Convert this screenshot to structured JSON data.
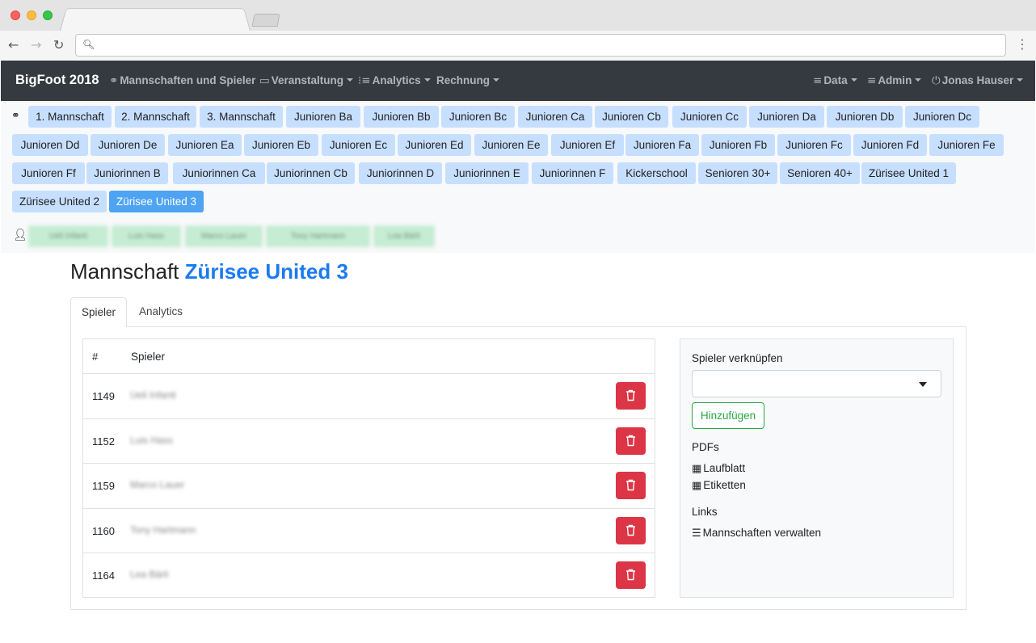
{
  "app": {
    "brand": "BigFoot 2018",
    "nav_left": [
      {
        "label": "Mannschaften und Spieler",
        "icon": "team-icon",
        "glyph": "⚭",
        "caret": false
      },
      {
        "label": "Veranstaltung",
        "icon": "calendar-icon",
        "glyph": "▭",
        "caret": true
      },
      {
        "label": "Analytics",
        "icon": "list-icon",
        "glyph": "⁝≡",
        "caret": true
      },
      {
        "label": "Rechnung",
        "icon": "",
        "glyph": "",
        "caret": true
      }
    ],
    "nav_right": [
      {
        "label": "Data",
        "icon": "menu-icon",
        "glyph": "≡",
        "caret": true
      },
      {
        "label": "Admin",
        "icon": "menu-icon",
        "glyph": "≡",
        "caret": true
      },
      {
        "label": "Jonas Hauser",
        "icon": "power-icon",
        "glyph": "⏻",
        "caret": true
      }
    ]
  },
  "teams": [
    "1. Mannschaft",
    "2. Mannschaft",
    "3. Mannschaft",
    "Junioren Ba",
    "Junioren Bb",
    "Junioren Bc",
    "Junioren Ca",
    "Junioren Cb",
    "Junioren Cc",
    "Junioren Da",
    "Junioren Db",
    "Junioren Dc",
    "Junioren Dd",
    "Junioren De",
    "Junioren Ea",
    "Junioren Eb",
    "Junioren Ec",
    "Junioren Ed",
    "Junioren Ee",
    "Junioren Ef",
    "Junioren Fa",
    "Junioren Fb",
    "Junioren Fc",
    "Junioren Fd",
    "Junioren Fe",
    "Junioren Ff",
    "Juniorinnen B",
    "Juniorinnen Ca",
    "Juniorinnen Cb",
    "Juniorinnen D",
    "Juniorinnen E",
    "Juniorinnen F",
    "Kickerschool",
    "Senioren 30+",
    "Senioren 40+",
    "Zürisee United 1",
    "Zürisee United 2",
    "Zürisee United 3"
  ],
  "active_team": "Zürisee United 3",
  "player_pills": [
    "Ueli Infanti",
    "Luis Hass",
    "Marco Lauer",
    "Tony Hartmann",
    "Lea Bärli"
  ],
  "page": {
    "heading_prefix": "Mannschaft",
    "heading_team": "Zürisee United 3",
    "tabs": [
      "Spieler",
      "Analytics"
    ]
  },
  "table": {
    "col_num": "#",
    "col_player": "Spieler",
    "rows": [
      {
        "id": "1149",
        "name": "Ueli Infanti"
      },
      {
        "id": "1152",
        "name": "Luis Hass"
      },
      {
        "id": "1159",
        "name": "Marco Lauer"
      },
      {
        "id": "1160",
        "name": "Tony Hartmann"
      },
      {
        "id": "1164",
        "name": "Lea Bärli"
      }
    ]
  },
  "side": {
    "link_label": "Spieler verknüpfen",
    "select_value": "",
    "add_button": "Hinzufügen",
    "pdfs_label": "PDFs",
    "pdfs": [
      "Laufblatt",
      "Etiketten"
    ],
    "links_label": "Links",
    "links": [
      "Mannschaften verwalten"
    ]
  },
  "colors": {
    "navbar": "#343a40",
    "pill": "#c7dfff",
    "pill_active": "#4ea3f3",
    "player_pill": "#c6ecd4",
    "heading_accent": "#1a7bf0",
    "danger": "#dc3545",
    "success": "#28a745"
  }
}
